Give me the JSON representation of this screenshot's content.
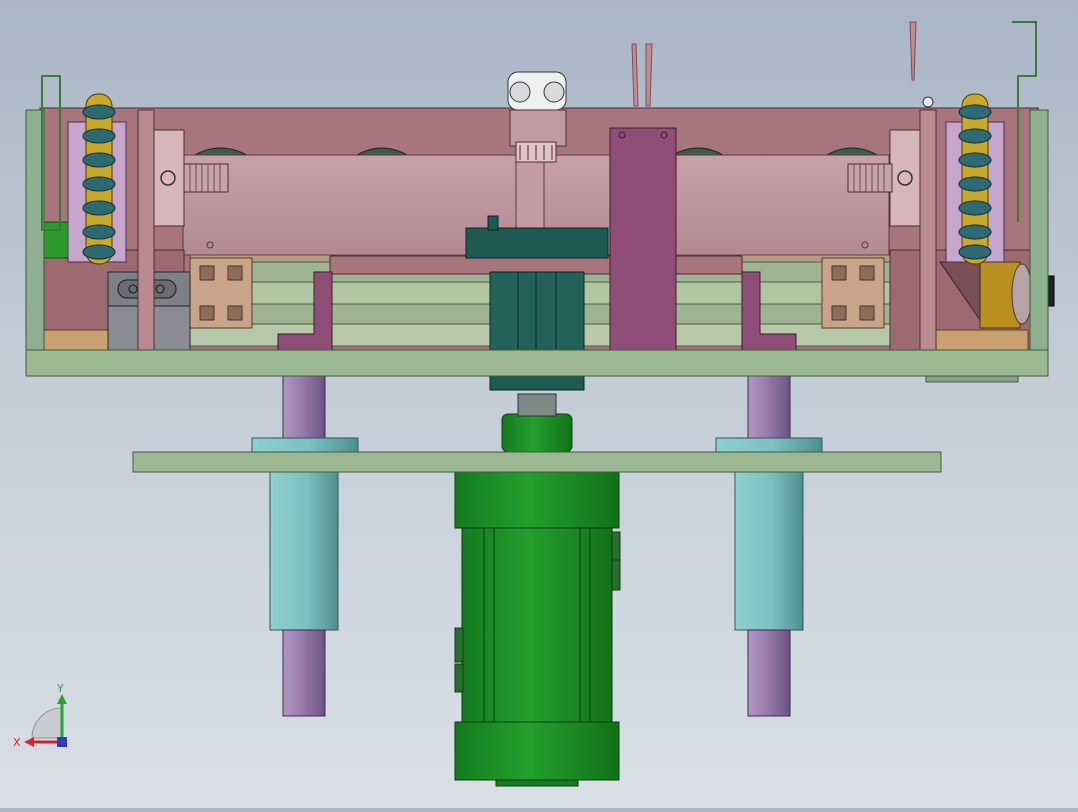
{
  "triad": {
    "x_label": "X",
    "y_label": "Y",
    "x_color": "#d8242a",
    "y_color": "#2aa43a",
    "z_color": "#2c3bbd"
  },
  "palette": {
    "frame_green": "#8fb090",
    "housing_mauve": "#a6767c",
    "rail_pink": "#c49aa3",
    "bracket_magenta": "#8f4e78",
    "motor_green": "#1f8a2a",
    "column_cyan": "#7cbfc0",
    "shaft_violet": "#9577a8",
    "plate_green": "#9bb893",
    "sprocket_gold": "#c9a92a",
    "profile_tan": "#c9a488",
    "cylinder_teal": "#1f5a52"
  }
}
